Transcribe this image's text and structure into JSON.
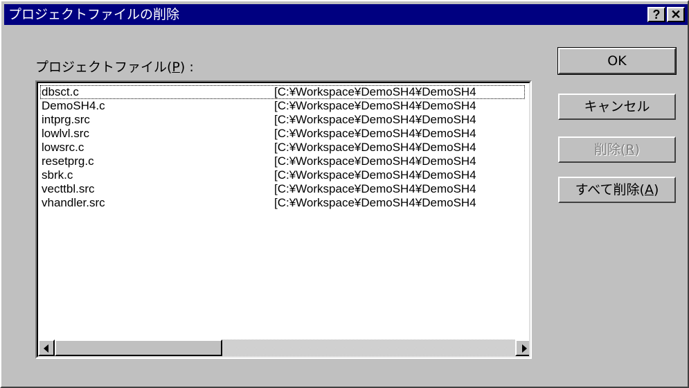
{
  "window": {
    "title": "プロジェクトファイルの削除",
    "help_glyph": "?",
    "close_glyph": "✕"
  },
  "list": {
    "label_prefix": "プロジェクトファイル(",
    "label_mnemonic": "P",
    "label_suffix": ") :",
    "rows": [
      {
        "name": "dbsct.c",
        "path": "[C:¥Workspace¥DemoSH4¥DemoSH4"
      },
      {
        "name": "DemoSH4.c",
        "path": "[C:¥Workspace¥DemoSH4¥DemoSH4"
      },
      {
        "name": "intprg.src",
        "path": "[C:¥Workspace¥DemoSH4¥DemoSH4"
      },
      {
        "name": "lowlvl.src",
        "path": "[C:¥Workspace¥DemoSH4¥DemoSH4"
      },
      {
        "name": "lowsrc.c",
        "path": "[C:¥Workspace¥DemoSH4¥DemoSH4"
      },
      {
        "name": "resetprg.c",
        "path": "[C:¥Workspace¥DemoSH4¥DemoSH4"
      },
      {
        "name": "sbrk.c",
        "path": "[C:¥Workspace¥DemoSH4¥DemoSH4"
      },
      {
        "name": "vecttbl.src",
        "path": "[C:¥Workspace¥DemoSH4¥DemoSH4"
      },
      {
        "name": "vhandler.src",
        "path": "[C:¥Workspace¥DemoSH4¥DemoSH4"
      }
    ]
  },
  "buttons": {
    "ok": "OK",
    "cancel": "キャンセル",
    "delete_prefix": "削除(",
    "delete_mnemonic": "R",
    "delete_suffix": ")",
    "delete_all_prefix": "すべて削除(",
    "delete_all_mnemonic": "A",
    "delete_all_suffix": ")"
  },
  "colors": {
    "title_bar": "#000080",
    "face": "#c0c0c0",
    "disabled_text": "#808080"
  },
  "icons": {
    "scroll_left": "left-arrow-icon",
    "scroll_right": "right-arrow-icon"
  }
}
